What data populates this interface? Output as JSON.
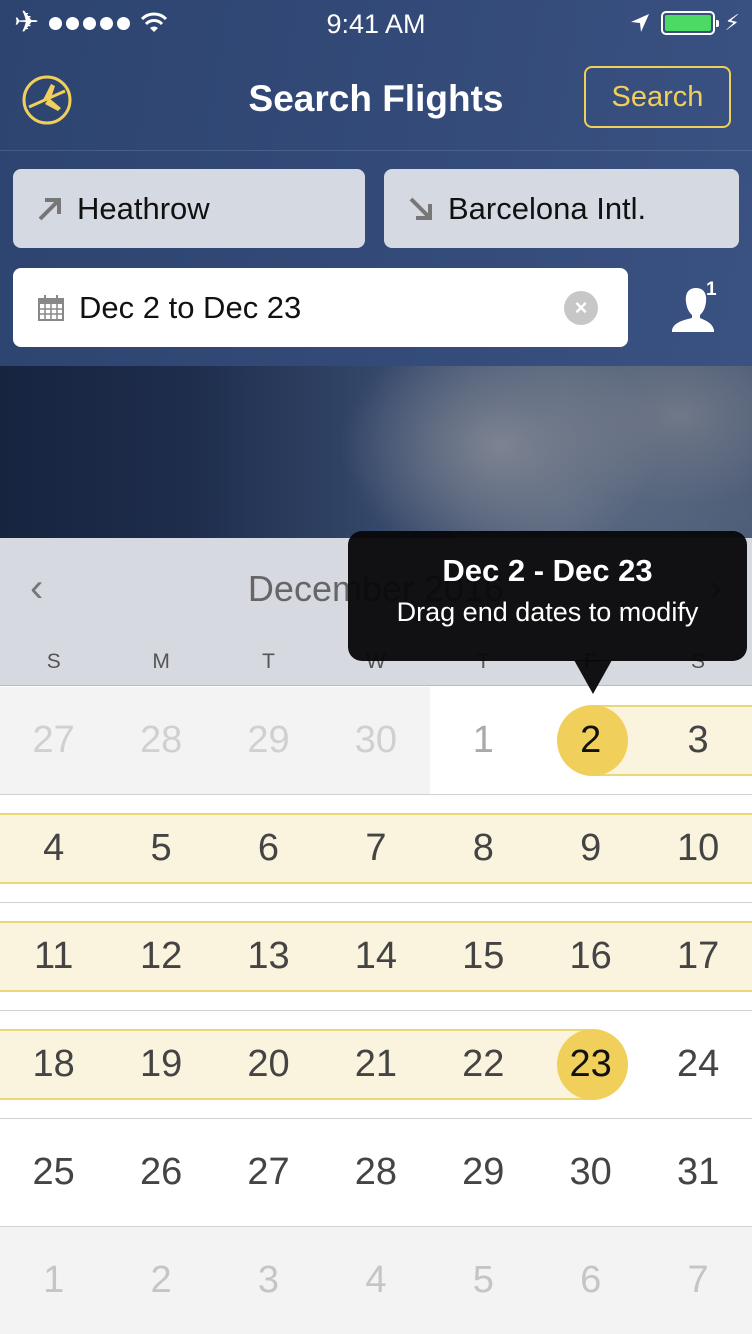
{
  "status_bar": {
    "time": "9:41 AM",
    "airplane_icon": "airplane-mode-icon",
    "signal_dots": 5,
    "wifi_icon": "wifi-icon",
    "location_icon": "location-arrow-icon",
    "battery_level_percent": 100,
    "charging_icon": "bolt-icon"
  },
  "nav": {
    "logo_icon": "airplane-logo-icon",
    "title": "Search Flights",
    "search_label": "Search"
  },
  "search_form": {
    "origin": {
      "icon": "takeoff-arrow-icon",
      "value": "Heathrow"
    },
    "destination": {
      "icon": "landing-arrow-icon",
      "value": "Barcelona Intl."
    },
    "dates": {
      "icon": "calendar-icon",
      "value": "Dec 2 to Dec 23",
      "clear_icon": "clear-icon"
    },
    "travelers": {
      "icon": "person-icon",
      "count": "1"
    }
  },
  "calendar": {
    "month_title": "December 2016",
    "prev_icon": "‹",
    "next_icon": "›",
    "weekdays": [
      "S",
      "M",
      "T",
      "W",
      "T",
      "F",
      "S"
    ],
    "weeks": [
      [
        "27",
        "28",
        "29",
        "30",
        "1",
        "2",
        "3"
      ],
      [
        "4",
        "5",
        "6",
        "7",
        "8",
        "9",
        "10"
      ],
      [
        "11",
        "12",
        "13",
        "14",
        "15",
        "16",
        "17"
      ],
      [
        "18",
        "19",
        "20",
        "21",
        "22",
        "23",
        "24"
      ],
      [
        "25",
        "26",
        "27",
        "28",
        "29",
        "30",
        "31"
      ],
      [
        "1",
        "2",
        "3",
        "4",
        "5",
        "6",
        "7"
      ]
    ],
    "selected_start": "2",
    "selected_end": "23",
    "accent_color": "#f0cf5a",
    "range_color": "#faf3dd"
  },
  "tooltip": {
    "title": "Dec 2 - Dec 23",
    "subtitle": "Drag end dates to modify"
  }
}
